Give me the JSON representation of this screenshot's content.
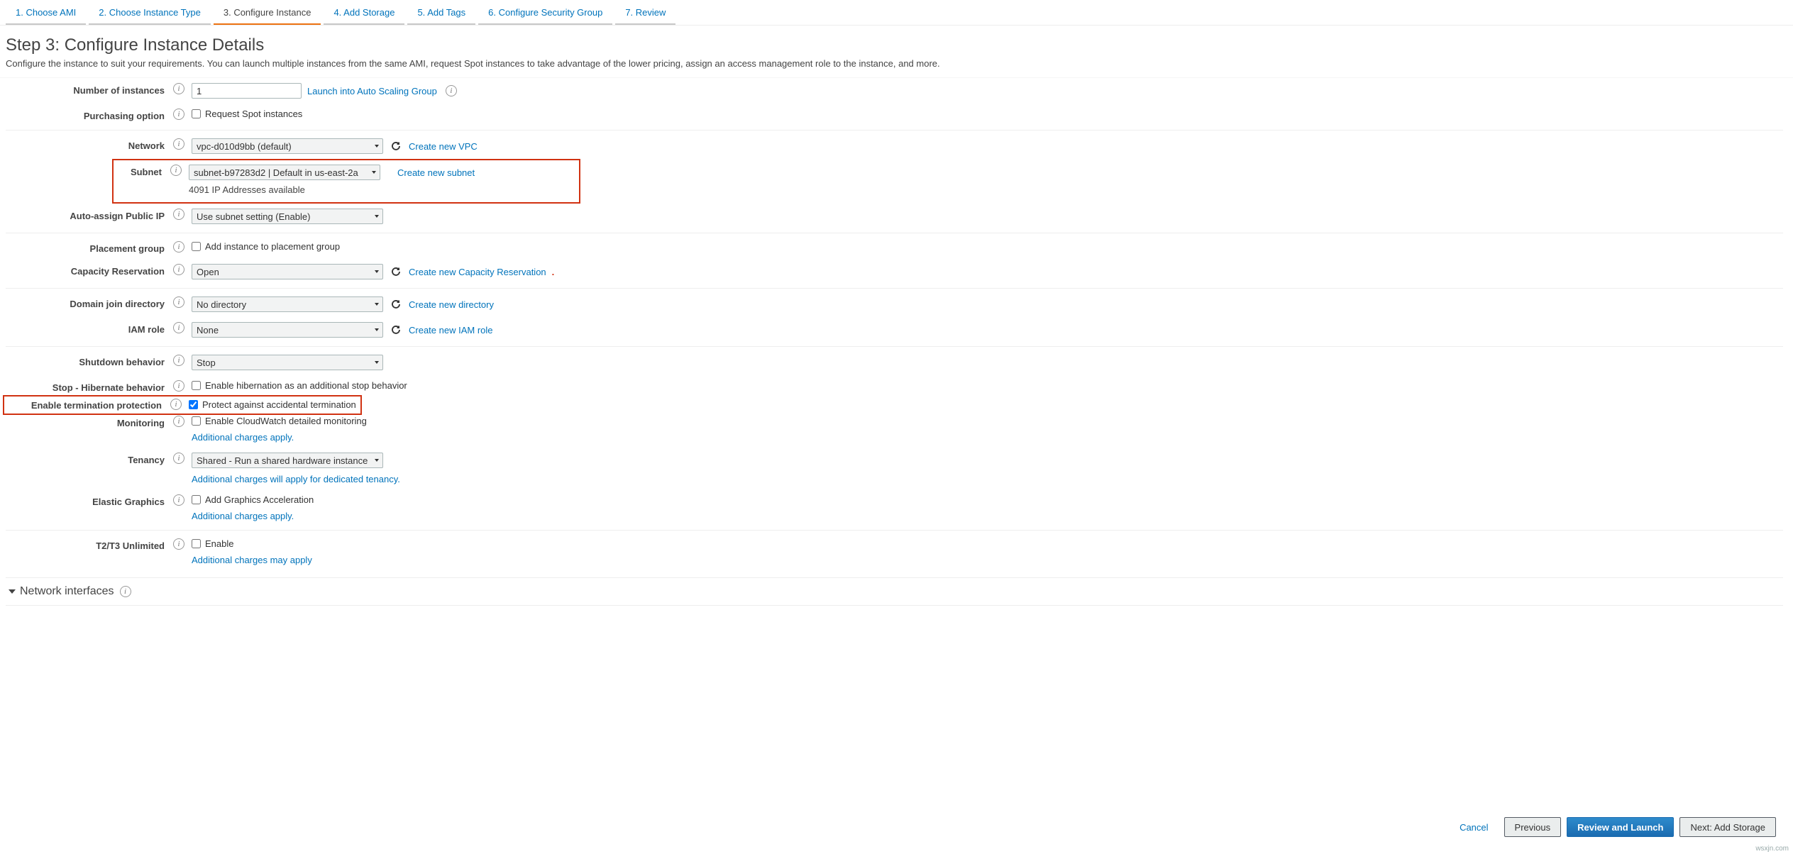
{
  "tabs": [
    {
      "label": "1. Choose AMI"
    },
    {
      "label": "2. Choose Instance Type"
    },
    {
      "label": "3. Configure Instance",
      "active": true
    },
    {
      "label": "4. Add Storage"
    },
    {
      "label": "5. Add Tags"
    },
    {
      "label": "6. Configure Security Group"
    },
    {
      "label": "7. Review"
    }
  ],
  "title": "Step 3: Configure Instance Details",
  "subtitle": "Configure the instance to suit your requirements. You can launch multiple instances from the same AMI, request Spot instances to take advantage of the lower pricing, assign an access management role to the instance, and more.",
  "form": {
    "instances": {
      "label": "Number of instances",
      "value": "1",
      "link": "Launch into Auto Scaling Group"
    },
    "purchasing": {
      "label": "Purchasing option",
      "checkbox": "Request Spot instances"
    },
    "network": {
      "label": "Network",
      "value": "vpc-d010d9bb (default)",
      "link": "Create new VPC"
    },
    "subnet": {
      "label": "Subnet",
      "value": "subnet-b97283d2 | Default in us-east-2a",
      "link": "Create new subnet",
      "note": "4091 IP Addresses available"
    },
    "autoip": {
      "label": "Auto-assign Public IP",
      "value": "Use subnet setting (Enable)"
    },
    "placement": {
      "label": "Placement group",
      "checkbox": "Add instance to placement group"
    },
    "capacity": {
      "label": "Capacity Reservation",
      "value": "Open",
      "link": "Create new Capacity Reservation"
    },
    "domain": {
      "label": "Domain join directory",
      "value": "No directory",
      "link": "Create new directory"
    },
    "iam": {
      "label": "IAM role",
      "value": "None",
      "link": "Create new IAM role"
    },
    "shutdown": {
      "label": "Shutdown behavior",
      "value": "Stop"
    },
    "hibernate": {
      "label": "Stop - Hibernate behavior",
      "checkbox": "Enable hibernation as an additional stop behavior"
    },
    "termprotect": {
      "label": "Enable termination protection",
      "checkbox": "Protect against accidental termination"
    },
    "monitoring": {
      "label": "Monitoring",
      "checkbox": "Enable CloudWatch detailed monitoring",
      "sub": "Additional charges apply."
    },
    "tenancy": {
      "label": "Tenancy",
      "value": "Shared - Run a shared hardware instance",
      "sub": "Additional charges will apply for dedicated tenancy."
    },
    "elastic": {
      "label": "Elastic Graphics",
      "checkbox": "Add Graphics Acceleration",
      "sub": "Additional charges apply."
    },
    "t2t3": {
      "label": "T2/T3 Unlimited",
      "checkbox": "Enable",
      "sub": "Additional charges may apply"
    }
  },
  "section": {
    "title": "Network interfaces"
  },
  "footer": {
    "cancel": "Cancel",
    "prev": "Previous",
    "review": "Review and Launch",
    "next": "Next: Add Storage"
  },
  "watermark": "wsxjn.com"
}
